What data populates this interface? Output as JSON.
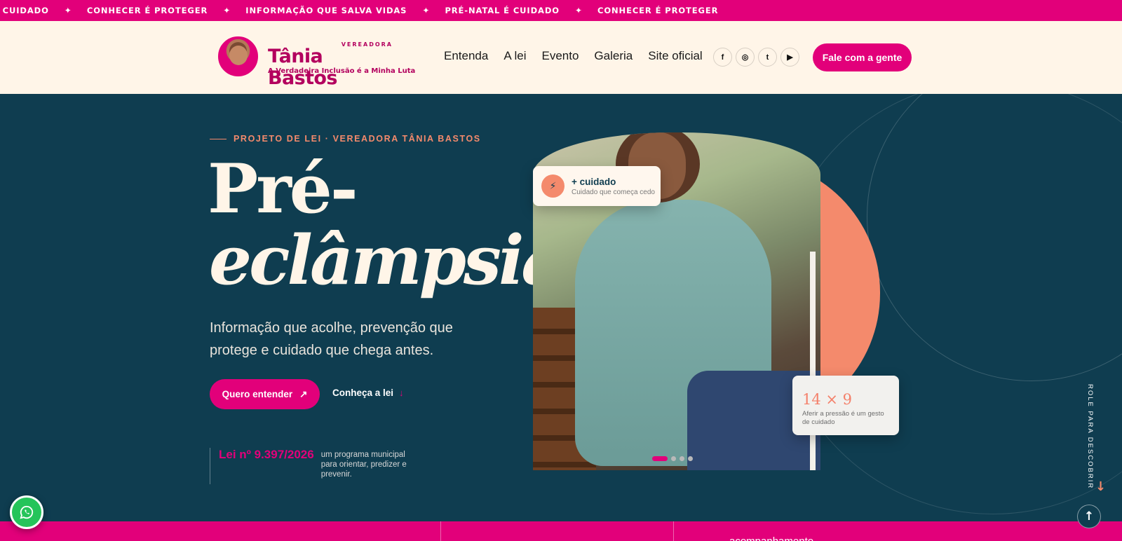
{
  "ticker": {
    "items": [
      "É CUIDADO",
      "CONHECER É PROTEGER",
      "INFORMAÇÃO QUE SALVA VIDAS",
      "PRÉ-NATAL É CUIDADO",
      "CONHECER É PROTEGER"
    ],
    "separator": "✦"
  },
  "header": {
    "logo": {
      "kicker": "VEREADORA",
      "name": "Tânia Bastos",
      "tagline": "A Verdadeira Inclusão é a Minha Luta"
    },
    "nav": [
      "Entenda",
      "A lei",
      "Evento",
      "Galeria",
      "Site oficial"
    ],
    "socials": [
      {
        "icon": "facebook-icon",
        "glyph": "f"
      },
      {
        "icon": "instagram-icon",
        "glyph": "◎"
      },
      {
        "icon": "twitter-icon",
        "glyph": "t"
      },
      {
        "icon": "youtube-icon",
        "glyph": "▶"
      }
    ],
    "cta_label": "Fale com a gente"
  },
  "hero": {
    "eyebrow": "PROJETO DE LEI · VEREADORA TÂNIA BASTOS",
    "title_line1": "Pré-",
    "title_line2": "eclâmpsia",
    "subtitle": "Informação que acolhe, prevenção que protege e cuidado que chega antes.",
    "primary_button": {
      "label": "Quero entender",
      "icon": "↗"
    },
    "secondary_button": {
      "label": "Conheça a lei",
      "icon": "↓"
    },
    "law": {
      "number": "Lei nº 9.397/2026",
      "description": "um programa municipal para orientar, predizer e prevenir."
    },
    "card_care": {
      "icon": "⚡",
      "title": "+ cuidado",
      "subtitle": "Cuidado que começa cedo"
    },
    "card_pressure": {
      "value": "14 × 9",
      "subtitle": "Aferir a pressão é um gesto de cuidado"
    },
    "carousel": {
      "total": 4,
      "active": 1
    },
    "scroll_hint": "ROLE PARA DESCOBRIR"
  },
  "bottom_strip": {
    "text": "acompanhamento"
  },
  "colors": {
    "brand_pink": "#e2007a",
    "hero_bg": "#0f3d50",
    "coral": "#f48a6c",
    "cream": "#fff5e8",
    "whatsapp_green": "#25c45a"
  }
}
